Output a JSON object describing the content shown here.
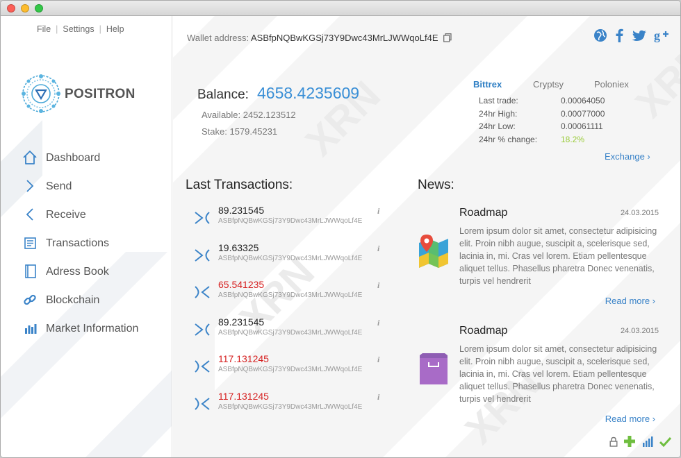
{
  "menu": {
    "file": "File",
    "settings": "Settings",
    "help": "Help"
  },
  "brand": {
    "name": "POSITRON"
  },
  "nav": [
    {
      "label": "Dashboard",
      "icon": "home-icon"
    },
    {
      "label": "Send",
      "icon": "chevron-right-icon"
    },
    {
      "label": "Receive",
      "icon": "chevron-left-icon"
    },
    {
      "label": "Transactions",
      "icon": "transactions-list-icon"
    },
    {
      "label": "Adress Book",
      "icon": "address-book-icon"
    },
    {
      "label": "Blockchain",
      "icon": "chain-link-icon"
    },
    {
      "label": "Market Information",
      "icon": "bar-chart-icon"
    }
  ],
  "wallet": {
    "label": "Wallet address: ",
    "address": "ASBfpNQBwKGSj73Y9Dwc43MrLJWWqoLf4E"
  },
  "social": [
    "globe-icon",
    "facebook-icon",
    "twitter-icon",
    "google-plus-icon"
  ],
  "balance": {
    "label": "Balance:",
    "value": "4658.4235609",
    "available": "Available: 2452.123512",
    "stake": "Stake: 1579.45231"
  },
  "market": {
    "tabs": [
      "Bittrex",
      "Cryptsy",
      "Poloniex"
    ],
    "stats": [
      {
        "label": "Last trade:",
        "value": "0.00064050"
      },
      {
        "label": "24hr High:",
        "value": "0.00077000"
      },
      {
        "label": "24hr Low:",
        "value": "0.00061111"
      },
      {
        "label": "24hr % change:",
        "value": "18.2%"
      }
    ],
    "exchange_link": "Exchange ›"
  },
  "transactions": {
    "title": "Last Transactions:",
    "items": [
      {
        "amount": "89.231545",
        "address": "ASBfpNQBwKGSj73Y9Dwc43MrLJWWqoLf4E",
        "direction": "in"
      },
      {
        "amount": "19.63325",
        "address": "ASBfpNQBwKGSj73Y9Dwc43MrLJWWqoLf4E",
        "direction": "in"
      },
      {
        "amount": "65.541235",
        "address": "ASBfpNQBwKGSj73Y9Dwc43MrLJWWqoLf4E",
        "direction": "out"
      },
      {
        "amount": "89.231545",
        "address": "ASBfpNQBwKGSj73Y9Dwc43MrLJWWqoLf4E",
        "direction": "in"
      },
      {
        "amount": "117.131245",
        "address": "ASBfpNQBwKGSj73Y9Dwc43MrLJWWqoLf4E",
        "direction": "out"
      },
      {
        "amount": "117.131245",
        "address": "ASBfpNQBwKGSj73Y9Dwc43MrLJWWqoLf4E",
        "direction": "out"
      }
    ],
    "info_label": "i"
  },
  "news": {
    "title": "News:",
    "items": [
      {
        "title": "Roadmap",
        "date": "24.03.2015",
        "body": "Lorem ipsum dolor sit amet, consectetur adipisicing elit. Proin nibh augue, suscipit a, scelerisque sed, lacinia in, mi. Cras vel lorem. Etiam pellentesque aliquet tellus. Phasellus pharetra Donec venenatis, turpis vel hendrerit",
        "more": "Read more ›",
        "icon": "map-pin-icon"
      },
      {
        "title": "Roadmap",
        "date": "24.03.2015",
        "body": "Lorem ipsum dolor sit amet, consectetur adipisicing elit. Proin nibh augue, suscipit a, scelerisque sed, lacinia in, mi. Cras vel lorem. Etiam pellentesque aliquet tellus. Phasellus pharetra Donec venenatis, turpis vel hendrerit",
        "more": "Read more ›",
        "icon": "shopping-bag-icon"
      }
    ]
  },
  "watermark": "XRN",
  "status_icons": [
    "lock-icon",
    "plus-icon",
    "signal-bars-icon",
    "checkmark-icon"
  ],
  "colors": {
    "accent": "#3a8fd6",
    "negative": "#d62020",
    "positive": "#9acb3a",
    "sidebar_icon": "#3a83c8"
  }
}
